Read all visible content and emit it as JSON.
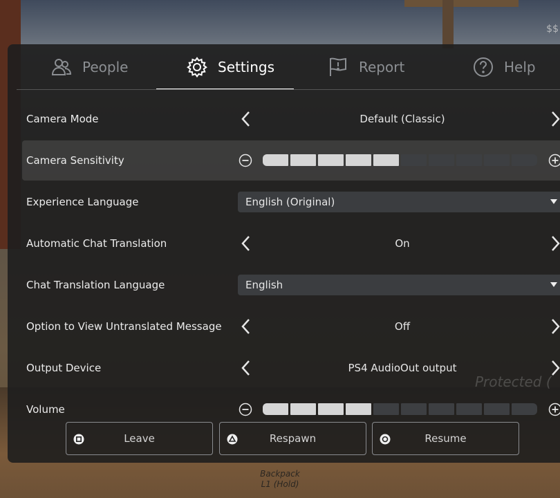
{
  "corner_text": "$$",
  "hint": {
    "line1": "Backpack",
    "line2": "L1 (Hold)"
  },
  "tabs": [
    {
      "label": "People"
    },
    {
      "label": "Settings"
    },
    {
      "label": "Report"
    },
    {
      "label": "Help"
    }
  ],
  "active_tab": "Settings",
  "settings": {
    "camera_mode": {
      "label": "Camera Mode",
      "value": "Default (Classic)"
    },
    "camera_sensitivity": {
      "label": "Camera Sensitivity",
      "level": 5,
      "max": 10
    },
    "experience_language": {
      "label": "Experience Language",
      "value": "English (Original)"
    },
    "auto_chat_translation": {
      "label": "Automatic Chat Translation",
      "value": "On"
    },
    "chat_translation_language": {
      "label": "Chat Translation Language",
      "value": "English"
    },
    "view_untranslated": {
      "label": "Option to View Untranslated Message",
      "value": "Off"
    },
    "output_device": {
      "label": "Output Device",
      "value": "PS4 AudioOut output"
    },
    "volume": {
      "label": "Volume",
      "level": 4,
      "max": 10
    }
  },
  "overlay_text": "Protected (",
  "buttons": {
    "leave": "Leave",
    "respawn": "Respawn",
    "resume": "Resume"
  },
  "colors": {
    "accent": "#ffffff",
    "panel": "#1e1e1e",
    "slider_on": "#d6d6d6",
    "slider_off": "#3d3f42"
  }
}
